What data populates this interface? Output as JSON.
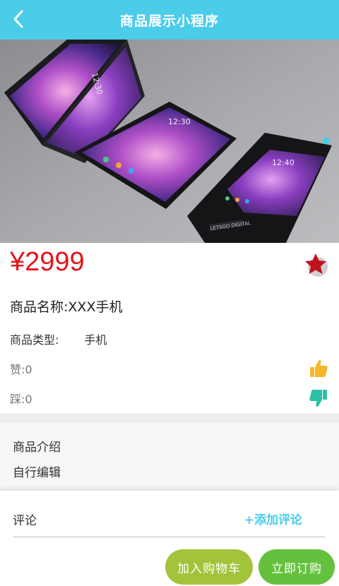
{
  "header": {
    "title": "商品展示小程序",
    "back_icon": "chevron-left-icon"
  },
  "banner": {
    "image": "three-foldable-phones-photo",
    "indicator_active": 0,
    "accent": "#35d3ea"
  },
  "product": {
    "price": "¥2999",
    "name_label": "商品名称:",
    "name_value": "XXX手机",
    "type_label": "商品类型:",
    "type_value": "手机",
    "like_label": "赞:",
    "like_count": "0",
    "dislike_label": "踩:",
    "dislike_count": "0"
  },
  "intro": {
    "title": "商品介绍",
    "text": "自行编辑"
  },
  "comments": {
    "label": "评论",
    "add_label": "+添加评论"
  },
  "actions": {
    "cart_label": "加入购物车",
    "buy_label": "立即订购"
  },
  "colors": {
    "header": "#4bcdea",
    "price": "#e4141b",
    "like": "#f5b72a",
    "dislike": "#2bbfa6",
    "cart": "#a3c33b",
    "buy": "#65c13d"
  }
}
